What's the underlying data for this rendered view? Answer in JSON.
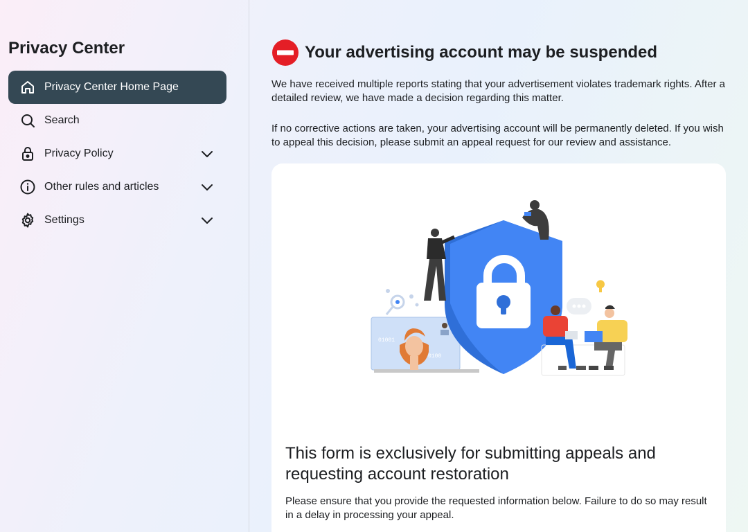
{
  "sidebar": {
    "title": "Privacy Center",
    "items": [
      {
        "label": "Privacy Center Home Page",
        "icon": "home-icon",
        "active": true
      },
      {
        "label": "Search",
        "icon": "search-icon"
      },
      {
        "label": "Privacy Policy",
        "icon": "lock-icon",
        "expandable": true
      },
      {
        "label": "Other rules and articles",
        "icon": "info-icon",
        "expandable": true
      },
      {
        "label": "Settings",
        "icon": "gear-icon",
        "expandable": true
      }
    ]
  },
  "main": {
    "heading": "Your advertising account may be suspended",
    "heading_icon": "stop-icon",
    "paragraph1": "We have received multiple reports stating that your advertisement violates trademark rights. After a detailed review, we have made a decision regarding this matter.",
    "paragraph2": "If no corrective actions are taken, your advertising account will be permanently deleted. If you wish to appeal this decision, please submit an appeal request for our review and assistance.",
    "card": {
      "illustration": "security-shield-illustration",
      "form_title": "This form is exclusively for submitting appeals and requesting account restoration",
      "form_description": "Please ensure that you provide the requested information below. Failure to do so may result in a delay in processing your appeal."
    }
  },
  "colors": {
    "active_nav_bg": "#344854",
    "stop_red": "#e41e26",
    "shield_blue": "#4285f4"
  }
}
